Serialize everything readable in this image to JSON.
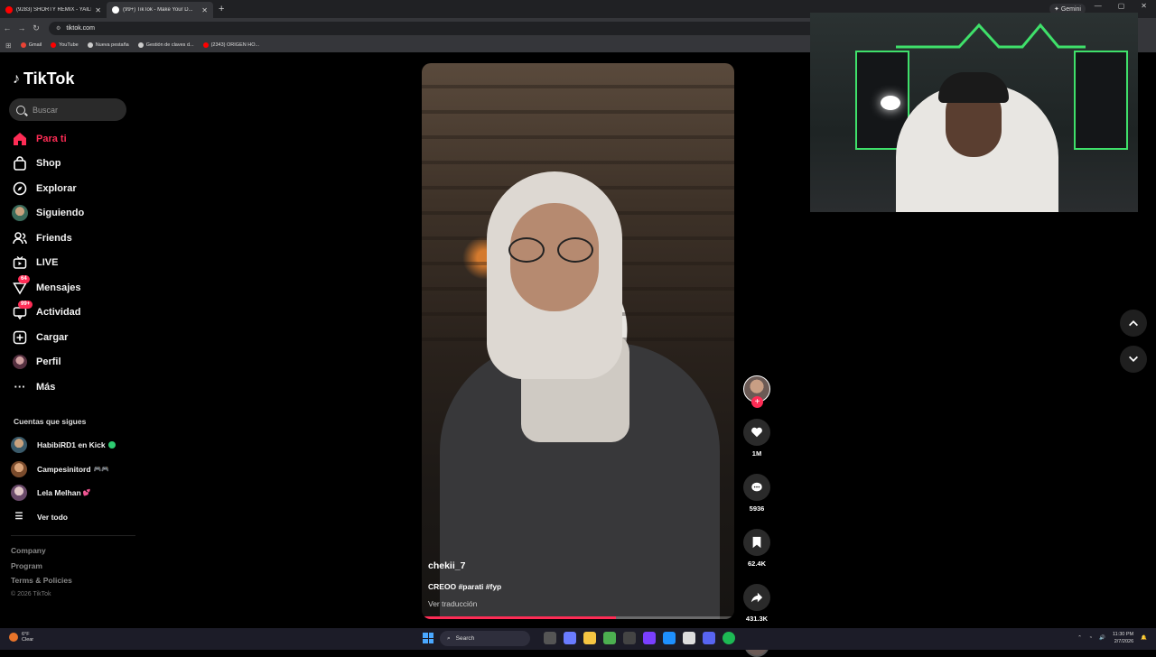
{
  "browser": {
    "tabs": [
      {
        "title": "(9283) SHORTY REMIX - YAILIN",
        "color": "#ff0000"
      },
      {
        "title": "(99+) TikTok - Make Your D...",
        "color": "#ffffff"
      }
    ],
    "url": "tiktok.com",
    "gemini_label": "Gemini",
    "bookmarks": [
      {
        "label": "Gmail",
        "color": "#ea4335"
      },
      {
        "label": "YouTube",
        "color": "#ff0000"
      },
      {
        "label": "Nueva pestaña",
        "color": "#cccccc"
      },
      {
        "label": "Gestión de claves d...",
        "color": "#cccccc"
      },
      {
        "label": "(2343) ORIGEN HO...",
        "color": "#ff0000"
      }
    ]
  },
  "sidebar": {
    "logo": "TikTok",
    "search_placeholder": "Buscar",
    "menu": [
      {
        "label": "Para ti",
        "icon": "home-icon",
        "active": true
      },
      {
        "label": "Shop",
        "icon": "shop-icon"
      },
      {
        "label": "Explorar",
        "icon": "compass-icon"
      },
      {
        "label": "Siguiendo",
        "icon": "following-avatar-icon"
      },
      {
        "label": "Friends",
        "icon": "friends-icon"
      },
      {
        "label": "LIVE",
        "icon": "live-icon"
      },
      {
        "label": "Mensajes",
        "icon": "messages-icon",
        "badge": "64"
      },
      {
        "label": "Actividad",
        "icon": "activity-icon",
        "badge": "99+"
      },
      {
        "label": "Cargar",
        "icon": "upload-icon"
      },
      {
        "label": "Perfil",
        "icon": "profile-icon"
      },
      {
        "label": "Más",
        "icon": "more-icon"
      }
    ],
    "following_title": "Cuentas que sigues",
    "following": [
      {
        "name": "HabibiRD1 en Kick",
        "suffix": ""
      },
      {
        "name": "Campesinitord",
        "suffix": "🎮🎮"
      },
      {
        "name": "Lela Melhan",
        "suffix": "💕"
      }
    ],
    "see_all": "Ver todo",
    "footer": {
      "company": "Company",
      "program": "Program",
      "terms": "Terms & Policies",
      "copyright": "© 2026 TikTok"
    }
  },
  "video": {
    "username": "chekii_7",
    "description": "CREOO #parati #fyp",
    "translate": "Ver traducción",
    "progress": 0.62,
    "likes": "1M",
    "comments": "5936",
    "saves": "62.4K",
    "shares": "431.3K"
  },
  "taskbar": {
    "temp": "6°F",
    "weather": "Clear",
    "search": "Search",
    "time": "11:30 PM",
    "date": "2/7/2026"
  },
  "colors": {
    "accent": "#fe2c55",
    "live": "#2ecc71",
    "neon": "#3fe06a"
  }
}
